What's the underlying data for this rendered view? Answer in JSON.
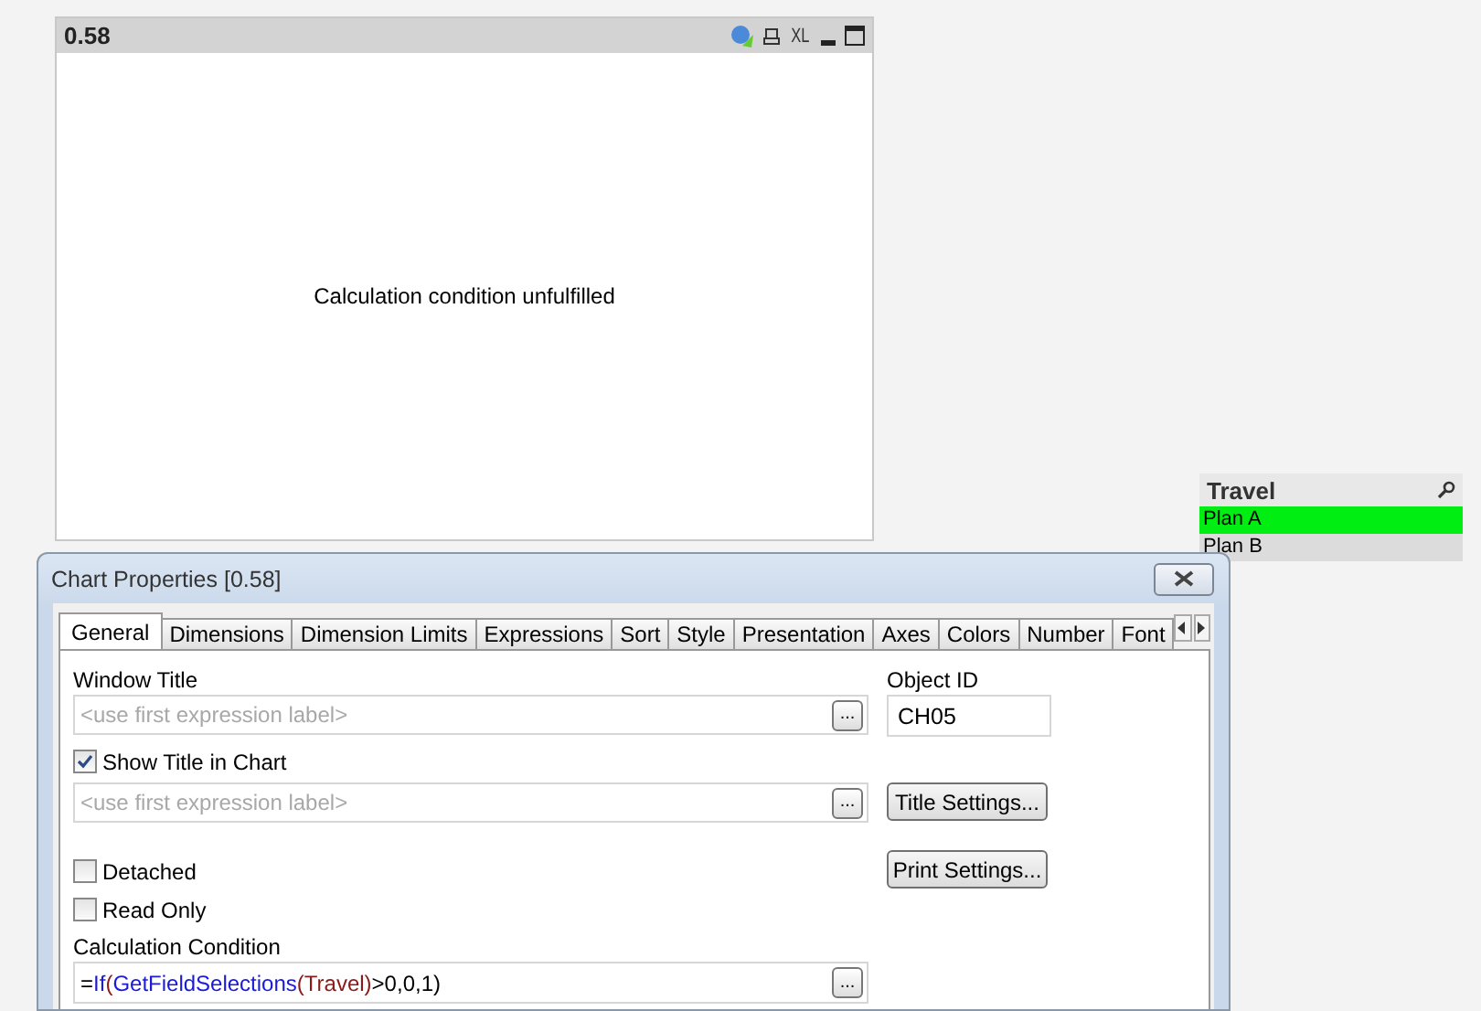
{
  "chart_object": {
    "title": "0.58",
    "caption_icons": [
      "XL"
    ],
    "message": "Calculation condition unfulfilled"
  },
  "listbox": {
    "title": "Travel",
    "items": [
      {
        "label": "Plan A",
        "selected": true
      },
      {
        "label": "Plan B",
        "selected": false
      }
    ]
  },
  "dialog": {
    "title": "Chart Properties [0.58]",
    "tabs": [
      {
        "label": "General",
        "selected": true
      },
      {
        "label": "Dimensions",
        "selected": false
      },
      {
        "label": "Dimension Limits",
        "selected": false
      },
      {
        "label": "Expressions",
        "selected": false
      },
      {
        "label": "Sort",
        "selected": false
      },
      {
        "label": "Style",
        "selected": false
      },
      {
        "label": "Presentation",
        "selected": false
      },
      {
        "label": "Axes",
        "selected": false
      },
      {
        "label": "Colors",
        "selected": false
      },
      {
        "label": "Number",
        "selected": false
      },
      {
        "label": "Font",
        "selected": false
      }
    ],
    "window_title": {
      "label": "Window Title",
      "placeholder": "<use first expression label>"
    },
    "object_id": {
      "label": "Object ID",
      "value": "CH05"
    },
    "show_title": {
      "label": "Show Title in Chart",
      "checked": true,
      "placeholder": "<use first expression label>"
    },
    "title_settings_button": "Title Settings...",
    "print_settings_button": "Print Settings...",
    "detached": {
      "label": "Detached",
      "checked": false
    },
    "read_only": {
      "label": "Read Only",
      "checked": false
    },
    "calculation_condition": {
      "label": "Calculation Condition",
      "tokens": [
        {
          "text": "=",
          "kind": "plain"
        },
        {
          "text": "If",
          "kind": "function"
        },
        {
          "text": "(",
          "kind": "field"
        },
        {
          "text": "GetFieldSelections",
          "kind": "function"
        },
        {
          "text": "(Travel)",
          "kind": "field"
        },
        {
          "text": ">0,0,1)",
          "kind": "plain"
        }
      ]
    },
    "ellipsis_button": "..."
  }
}
